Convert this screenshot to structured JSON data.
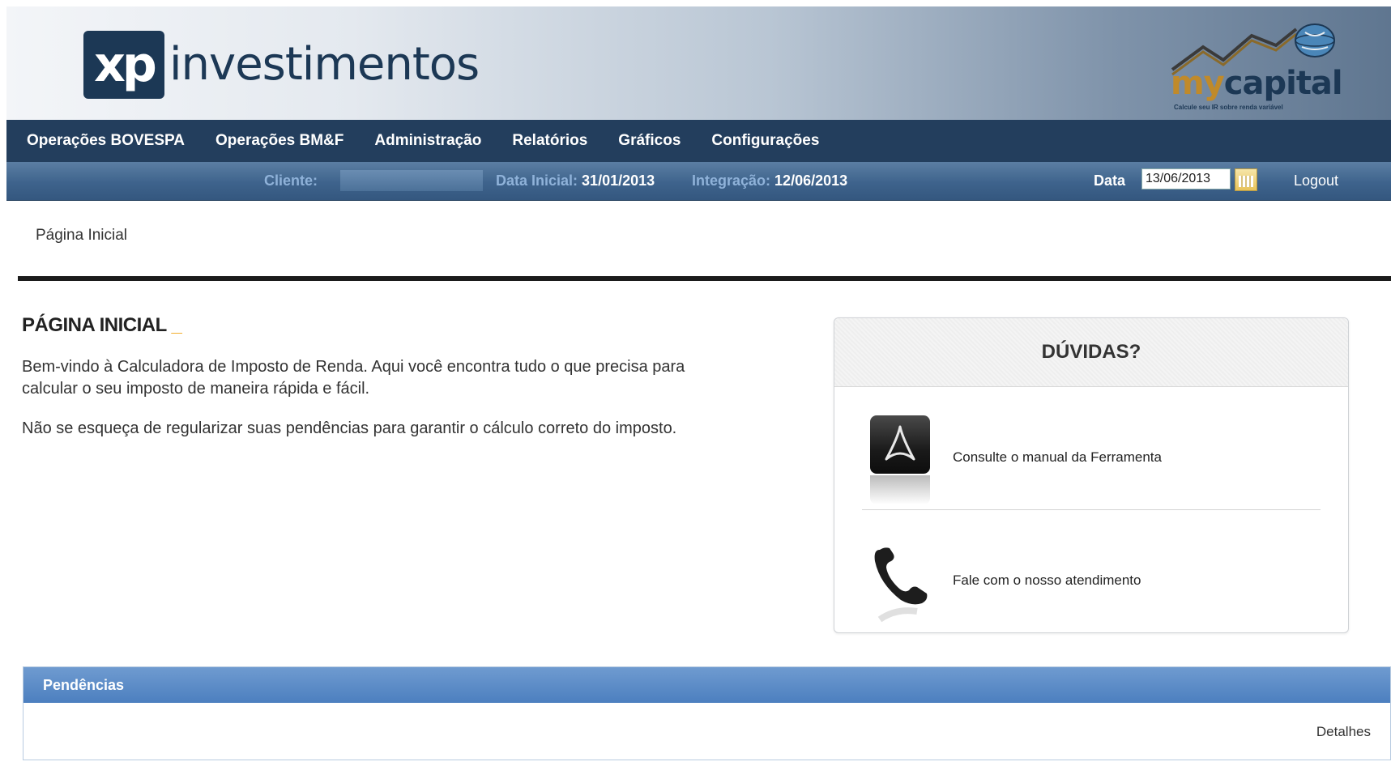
{
  "brand": {
    "xp_mark": "xp",
    "xp_word": "investimentos",
    "mycapital_my": "my",
    "mycapital_capital": "capital",
    "mycapital_tagline": "Calcule seu IR sobre renda variável"
  },
  "nav": {
    "items": [
      "Operações BOVESPA",
      "Operações BM&F",
      "Administração",
      "Relatórios",
      "Gráficos",
      "Configurações"
    ]
  },
  "infobar": {
    "client_label": "Cliente: ",
    "data_inicial_label": "Data Inicial:",
    "data_inicial_value": "31/01/2013",
    "integracao_label": "Integração:",
    "integracao_value": "12/06/2013",
    "data_label": "Data",
    "date_value": "13/06/2013",
    "logout": "Logout"
  },
  "breadcrumb": "Página Inicial",
  "main": {
    "title": "PÁGINA INICIAL",
    "title_accent": "_",
    "paragraph1": "Bem-vindo à Calculadora de Imposto de Renda. Aqui você encontra tudo o que precisa para calcular o seu imposto de maneira rápida e fácil.",
    "paragraph2": "Não se esqueça de regularizar suas pendências para garantir o cálculo correto do imposto."
  },
  "help": {
    "title": "DÚVIDAS?",
    "manual_text": "Consulte o manual da Ferramenta",
    "support_text": "Fale com o nosso atendimento"
  },
  "pendencias": {
    "title": "Pendências",
    "details_link": "Detalhes"
  },
  "colors": {
    "nav_bg": "#233e5d",
    "infobar_bg": "#3e638c",
    "accent": "#f2a81d",
    "panel_header": "#5b8ac6"
  },
  "icons": [
    "calendar-icon",
    "pdf-icon",
    "phone-icon",
    "chart-arrow-icon",
    "globe-icon"
  ]
}
